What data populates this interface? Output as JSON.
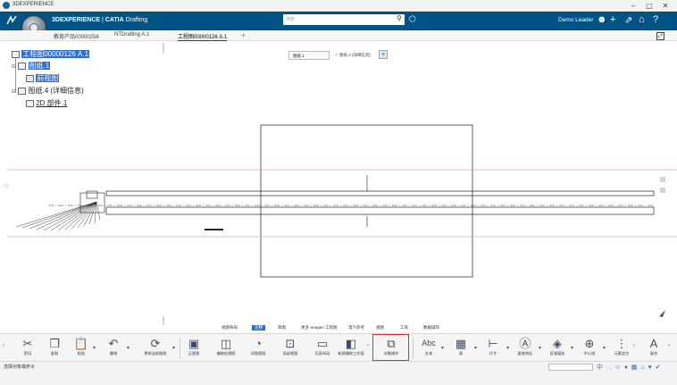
{
  "os_window": {
    "title": "3DEXPERIENCE",
    "minimize": "–",
    "maximize": "▢",
    "close": "✕"
  },
  "header": {
    "brand_bold": "3DEXPERIENCE",
    "brand_sep": " | ",
    "brand_app": "CATIA",
    "brand_module": " Drafting",
    "search_placeholder": "搜索",
    "search_icon": "search-icon",
    "user": "Demo Leader",
    "icons": [
      "tag-icon",
      "user-icon",
      "plus-icon",
      "share-icon",
      "home-icon",
      "help-icon"
    ],
    "color": "#005386"
  },
  "tabs": [
    {
      "label": "教育产品00000258",
      "active": false
    },
    {
      "label": "NTDrafting A.1",
      "active": false
    },
    {
      "label": "工程图00000126 A.1",
      "active": true
    }
  ],
  "tabs_add": "+",
  "tree": {
    "root": "工程图00000126 A.1",
    "sheet1": "图纸.1",
    "sheet1_child": "前视图",
    "sheet4": "图纸.4 (详细信息)",
    "sheet4_child": "2D 部件.1"
  },
  "sheet_toolbar": {
    "sheet": "图纸.1",
    "detail": "图纸.4 (详细信息)",
    "add": "+"
  },
  "command_tabs": [
    {
      "label": "视图布局",
      "active": false
    },
    {
      "label": "注释",
      "active": true
    },
    {
      "label": "草图",
      "active": false
    },
    {
      "label": "更多 Seagen 工程图",
      "active": false
    },
    {
      "label": "电气参考",
      "active": false
    },
    {
      "label": "视图",
      "active": false
    },
    {
      "label": "工具",
      "active": false
    },
    {
      "label": "数据操作",
      "active": false
    }
  ],
  "tools": [
    {
      "label": "剪切",
      "icon": "cut-icon",
      "glyph": "✂"
    },
    {
      "label": "复制",
      "icon": "copy-icon",
      "glyph": "❐"
    },
    {
      "label": "粘贴",
      "icon": "paste-icon",
      "glyph": "📋"
    },
    {
      "label": "撤销",
      "icon": "undo-icon",
      "glyph": "↶"
    },
    {
      "label": "更新当前图纸",
      "icon": "update-sheet-icon",
      "glyph": "⟳"
    },
    {
      "label": "正视图",
      "icon": "front-view-icon",
      "glyph": "▣"
    },
    {
      "label": "偏移剖视图",
      "icon": "offset-section-icon",
      "glyph": "◫"
    },
    {
      "label": "详细视图",
      "icon": "detail-view-icon",
      "glyph": "◔"
    },
    {
      "label": "局部视图",
      "icon": "clipping-view-icon",
      "glyph": "⊡"
    },
    {
      "label": "后面布局",
      "icon": "back-layout-icon",
      "glyph": "▭"
    },
    {
      "label": "新建辅助工作面",
      "icon": "new-workplane-icon",
      "glyph": "◧"
    },
    {
      "label": "对象操作",
      "icon": "object-operation-icon",
      "glyph": "⧉"
    },
    {
      "label": "文本",
      "icon": "text-icon",
      "glyph": "Abc"
    },
    {
      "label": "表",
      "icon": "table-icon",
      "glyph": "▦"
    },
    {
      "label": "尺寸",
      "icon": "dimension-icon",
      "glyph": "⊢"
    },
    {
      "label": "基准特征",
      "icon": "datum-feature-icon",
      "glyph": "Ⓐ"
    },
    {
      "label": "区域填充",
      "icon": "area-fill-icon",
      "glyph": "◈"
    },
    {
      "label": "中心线",
      "icon": "centerline-icon",
      "glyph": "⊕"
    },
    {
      "label": "元素定位",
      "icon": "element-position-icon",
      "glyph": "⋮"
    },
    {
      "label": "复杂",
      "icon": "complex-icon",
      "glyph": "A"
    }
  ],
  "status": {
    "message": "选择对象或命令",
    "ime": "中 ·, ☺ ♦ ▦ ⌂ ♥ ✔"
  },
  "colors": {
    "accent": "#2c6fd1",
    "highlight_box": "#d9312b",
    "sheet_boundary": "#e8a0a0"
  }
}
